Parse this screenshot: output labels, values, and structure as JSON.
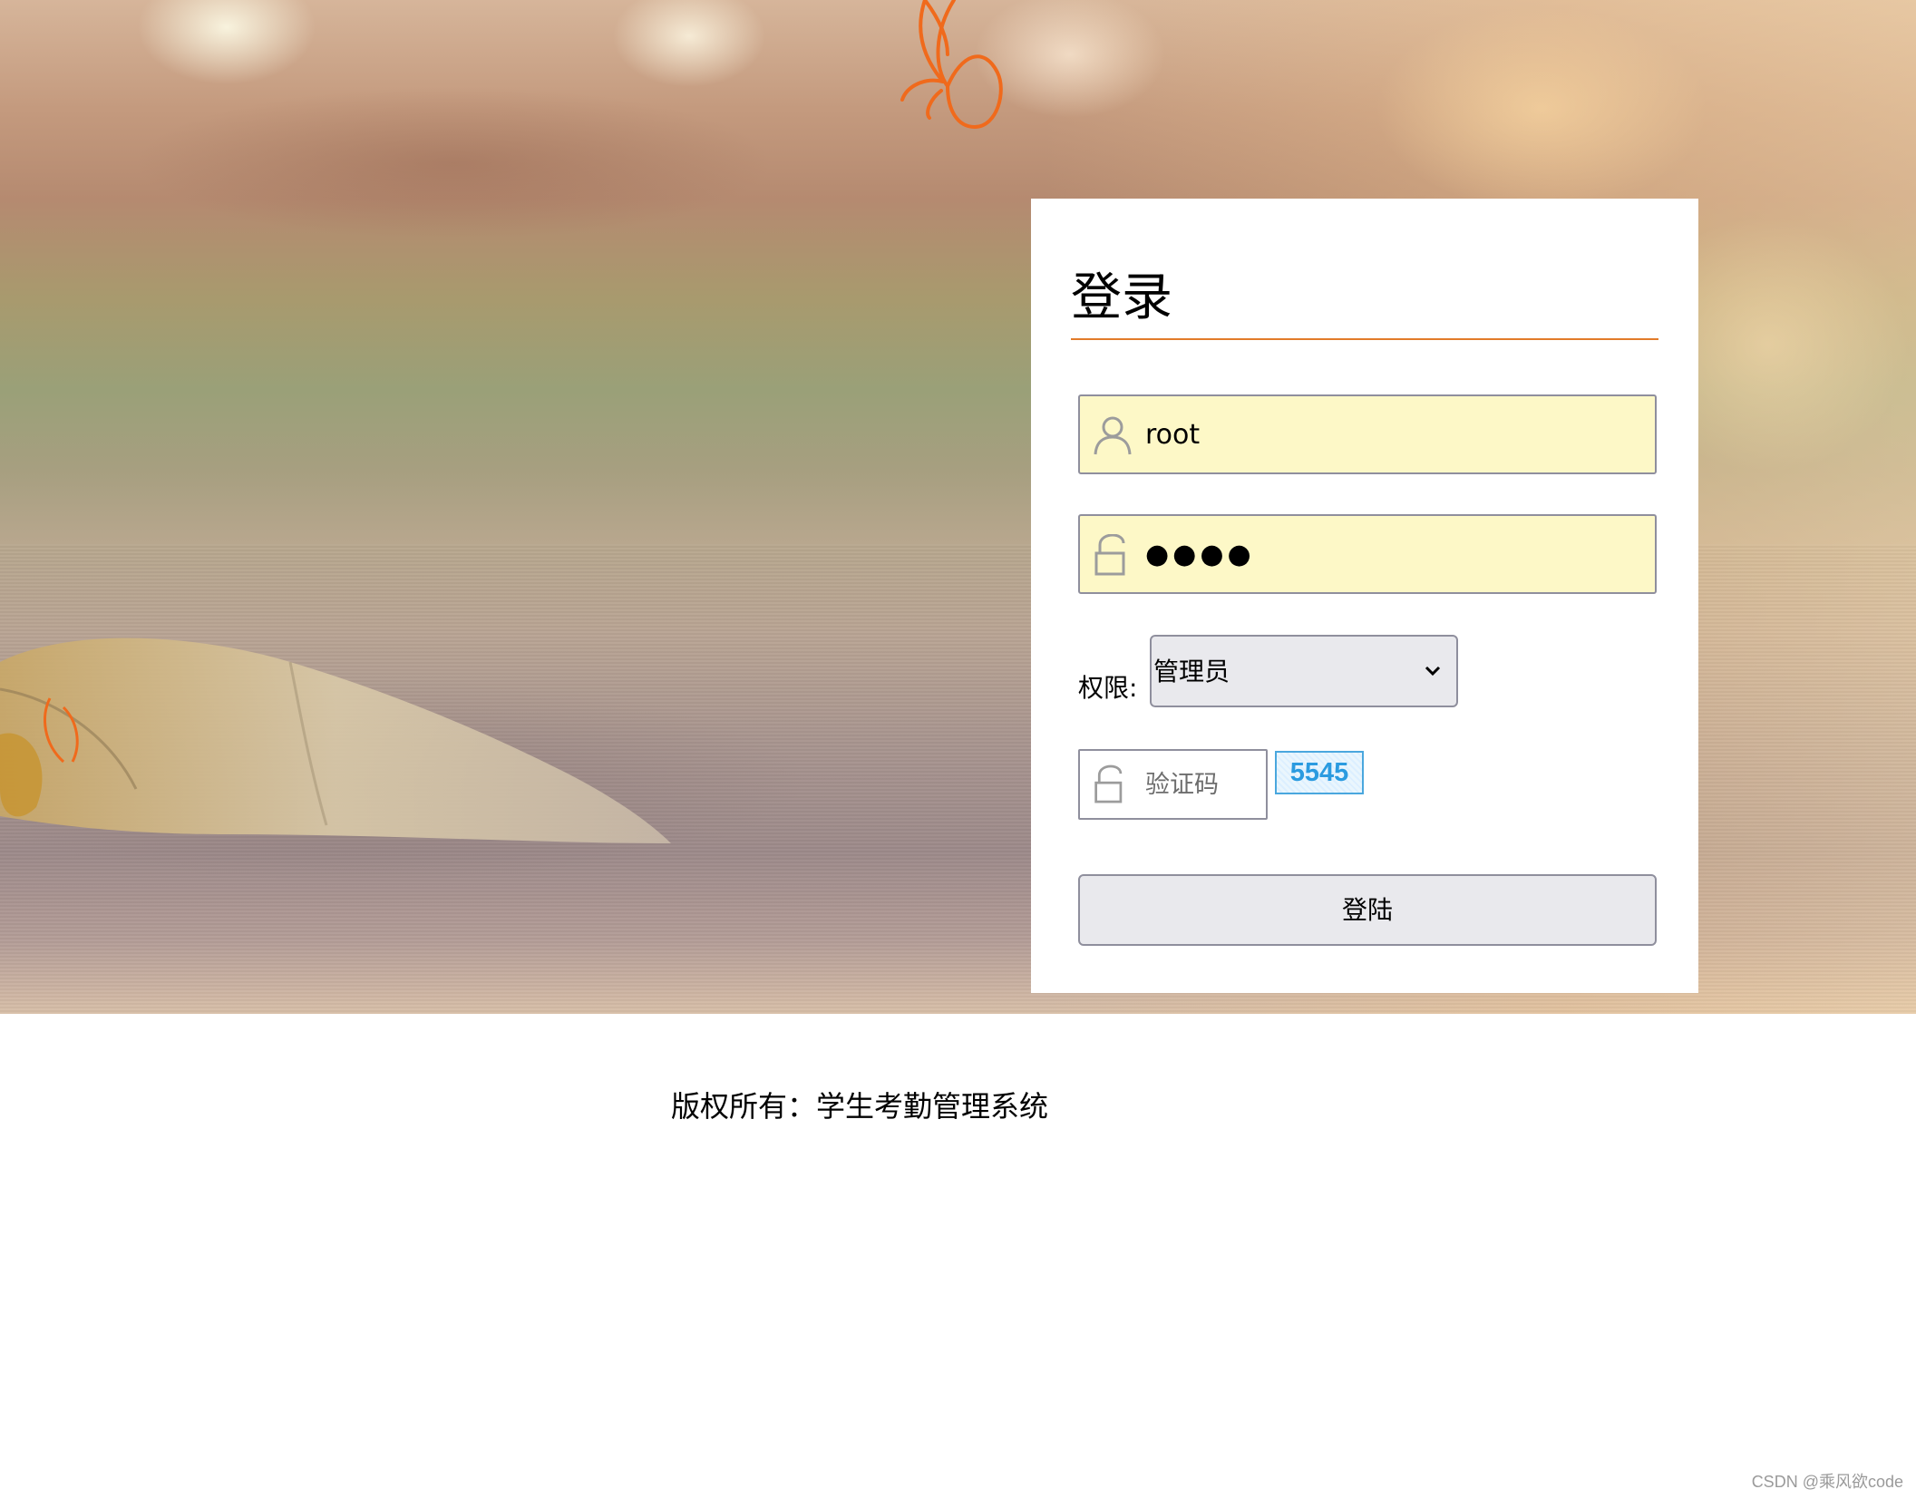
{
  "login": {
    "title": "登录",
    "username_value": "root",
    "password_value": "●●●●",
    "permission_label": "权限:",
    "permission_selected": "管理员",
    "captcha_placeholder": "验证码",
    "captcha_code": "5545",
    "submit_label": "登陆"
  },
  "footer": {
    "copyright": "版权所有：学生考勤管理系统"
  },
  "watermark": "CSDN @乘风欲code",
  "icons": {
    "username": "user-icon",
    "password": "unlock-icon",
    "captcha": "unlock-icon",
    "select": "chevron-down-icon"
  },
  "colors": {
    "accent": "#e27b2a",
    "autofill_bg": "#fdf8c7",
    "captcha_text": "#2b9be0"
  }
}
